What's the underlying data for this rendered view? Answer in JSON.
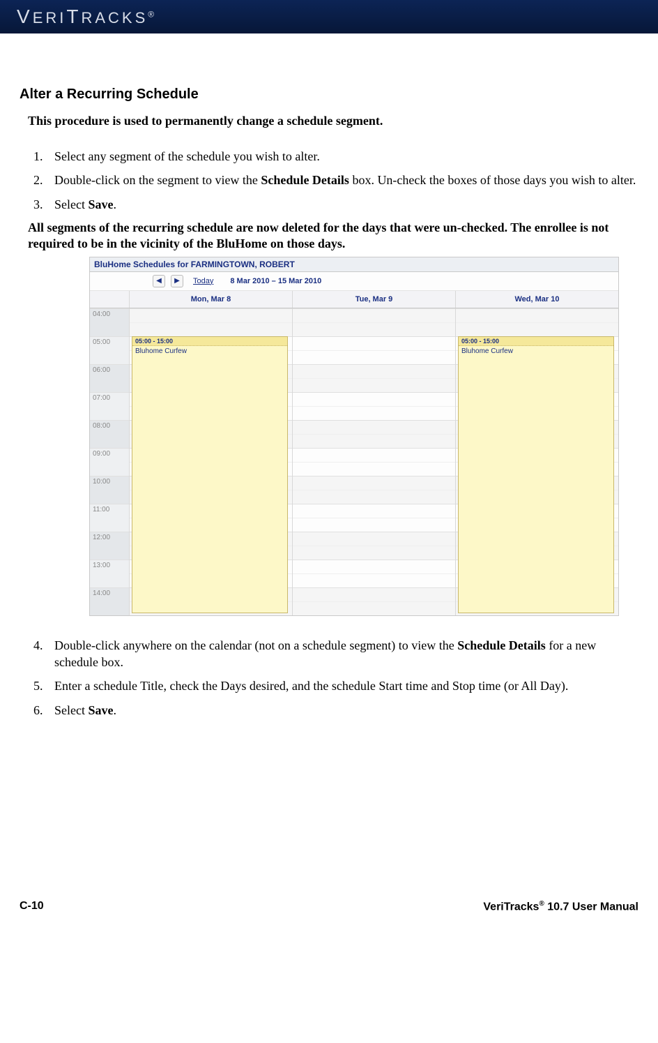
{
  "header": {
    "brand_prefix": "V",
    "brand_mid": "ERI",
    "brand_t": "T",
    "brand_suffix": "RACKS",
    "reg": "®"
  },
  "section_title": "Alter a Recurring Schedule",
  "intro": "This procedure is used to permanently change a schedule segment.",
  "steps_a": [
    {
      "n": "1",
      "text": "Select any segment of the schedule you wish to alter."
    },
    {
      "n": "2",
      "pre": "Double-click on the segment to view the ",
      "bold": "Schedule Details",
      "post": " box.  Un-check the boxes of those days you wish to alter."
    },
    {
      "n": "3",
      "pre": "Select ",
      "bold": "Save",
      "post": "."
    }
  ],
  "result": "All segments of the recurring schedule are now deleted for the days that were un-checked.  The enrollee is not required to be in the vicinity of the BluHome on those days.",
  "screenshot": {
    "title": "BluHome Schedules for FARMINGTOWN, ROBERT",
    "nav": {
      "prev": "◀",
      "next": "▶",
      "today": "Today",
      "range": "8 Mar 2010 – 15 Mar 2010"
    },
    "day_headers": [
      "Mon, Mar 8",
      "Tue, Mar 9",
      "Wed, Mar 10"
    ],
    "time_labels": [
      "04:00",
      "05:00",
      "06:00",
      "07:00",
      "08:00",
      "09:00",
      "10:00",
      "11:00",
      "12:00",
      "13:00",
      "14:00"
    ],
    "event_time": "05:00 - 15:00",
    "event_label": "Bluhome Curfew"
  },
  "steps_b": [
    {
      "n": "4",
      "pre": "Double-click anywhere on the calendar (not on a schedule segment) to view the ",
      "bold": "Schedule Details",
      "post": " for a new schedule box."
    },
    {
      "n": "5",
      "text": "Enter a schedule Title, check the Days desired, and the schedule Start time and Stop time (or All Day)."
    },
    {
      "n": "6",
      "pre": "Select ",
      "bold": "Save",
      "post": "."
    }
  ],
  "footer": {
    "left": "C-10",
    "right_pre": "VeriTracks",
    "right_reg": "®",
    "right_post": " 10.7 User Manual"
  }
}
